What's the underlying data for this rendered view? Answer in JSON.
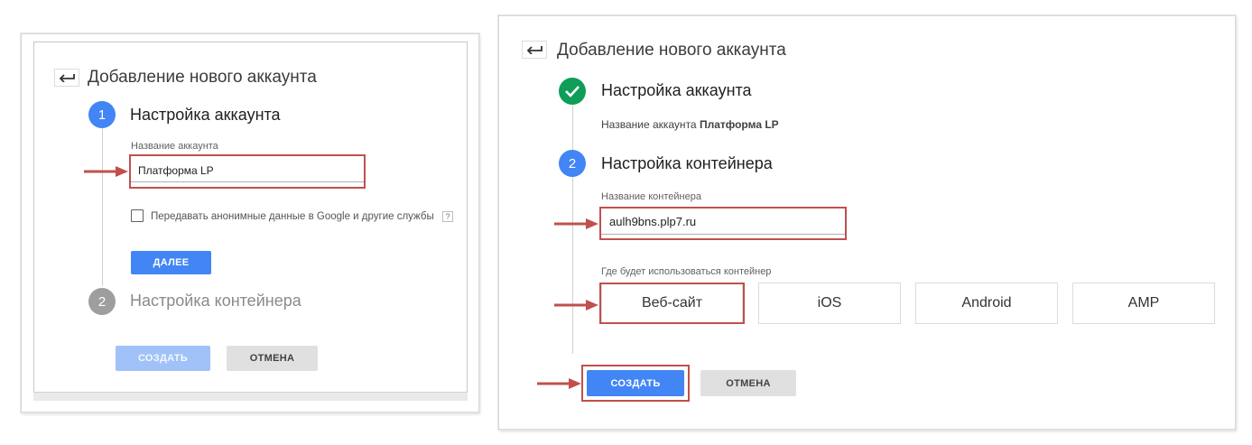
{
  "left_panel": {
    "title": "Добавление нового аккаунта",
    "step1": {
      "number": "1",
      "title": "Настройка аккаунта",
      "field_label": "Название аккаунта",
      "field_value": "Платформа LP",
      "checkbox_label": "Передавать анонимные данные в Google и другие службы",
      "help": "?",
      "next_label": "ДАЛЕЕ"
    },
    "step2": {
      "number": "2",
      "title": "Настройка контейнера"
    },
    "create_label": "СОЗДАТЬ",
    "cancel_label": "ОТМЕНА"
  },
  "right_panel": {
    "title": "Добавление нового аккаунта",
    "step1": {
      "title": "Настройка аккаунта",
      "summary_prefix": "Название аккаунта",
      "summary_value": "Платформа LP"
    },
    "step2": {
      "number": "2",
      "title": "Настройка контейнера",
      "field_label": "Название контейнера",
      "field_value": "aulh9bns.plp7.ru",
      "platform_label": "Где будет использоваться контейнер",
      "platforms": [
        "Веб-сайт",
        "iOS",
        "Android",
        "AMP"
      ]
    },
    "create_label": "СОЗДАТЬ",
    "cancel_label": "ОТМЕНА"
  },
  "colors": {
    "accent": "#4285f4",
    "success": "#0f9d58",
    "annotation": "#c0504d"
  },
  "icons": [
    "back-arrow-icon",
    "checkmark-icon",
    "annotation-arrow-icon"
  ]
}
